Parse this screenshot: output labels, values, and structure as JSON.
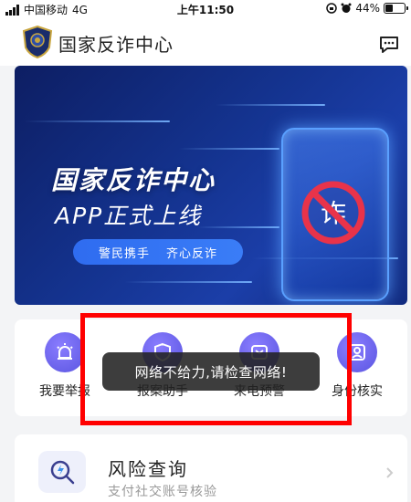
{
  "status_bar": {
    "carrier": "中国移动",
    "network": "4G",
    "time": "上午11:50",
    "battery_percent": "44%",
    "battery_level": 0.44,
    "icons": [
      "signal-icon",
      "lock-rotation-icon",
      "alarm-icon",
      "battery-icon"
    ]
  },
  "header": {
    "title": "国家反诈中心",
    "icons": [
      "police-badge-logo",
      "message-icon"
    ]
  },
  "banner": {
    "title": "国家反诈中心",
    "subtitle": "APP正式上线",
    "slogans": [
      "警民携手",
      "齐心反诈"
    ],
    "stamp_text": "诈"
  },
  "actions": [
    {
      "label": "我要举报",
      "icon": "alarm-light-icon"
    },
    {
      "label": "报案助手",
      "icon": "shield-icon"
    },
    {
      "label": "来电预警",
      "icon": "phone-warning-icon"
    },
    {
      "label": "身份核实",
      "icon": "id-card-icon"
    }
  ],
  "toast": {
    "message": "网络不给力,请检查网络!"
  },
  "risk_query": {
    "title": "风险查询",
    "subtitle": "支付社交账号核验"
  },
  "colors": {
    "banner_dark": "#0d1e63",
    "banner_accent": "#3a7df7",
    "action_icon": "#6a63ee",
    "annotation": "#ff0000",
    "toast_bg": "#222222"
  }
}
